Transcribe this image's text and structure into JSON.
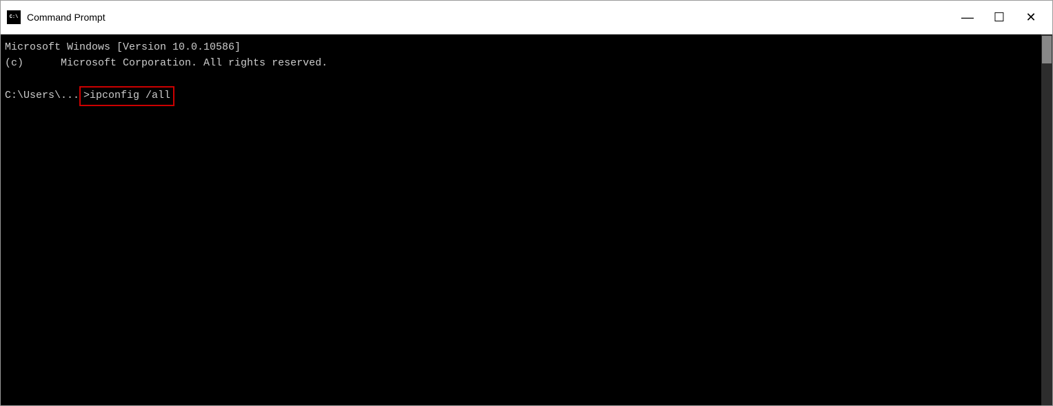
{
  "window": {
    "title": "Command Prompt",
    "icon_label": "cmd-icon"
  },
  "titlebar": {
    "minimize_label": "—",
    "maximize_label": "☐",
    "close_label": "✕"
  },
  "terminal": {
    "line1": "Microsoft Windows [Version 10.0.10586]",
    "line2": "(c)      Microsoft Corporation. All rights reserved.",
    "line3": "",
    "prompt": "C:\\Users\\...",
    "command": ">ipconfig /all",
    "scrollbar_visible": true
  }
}
